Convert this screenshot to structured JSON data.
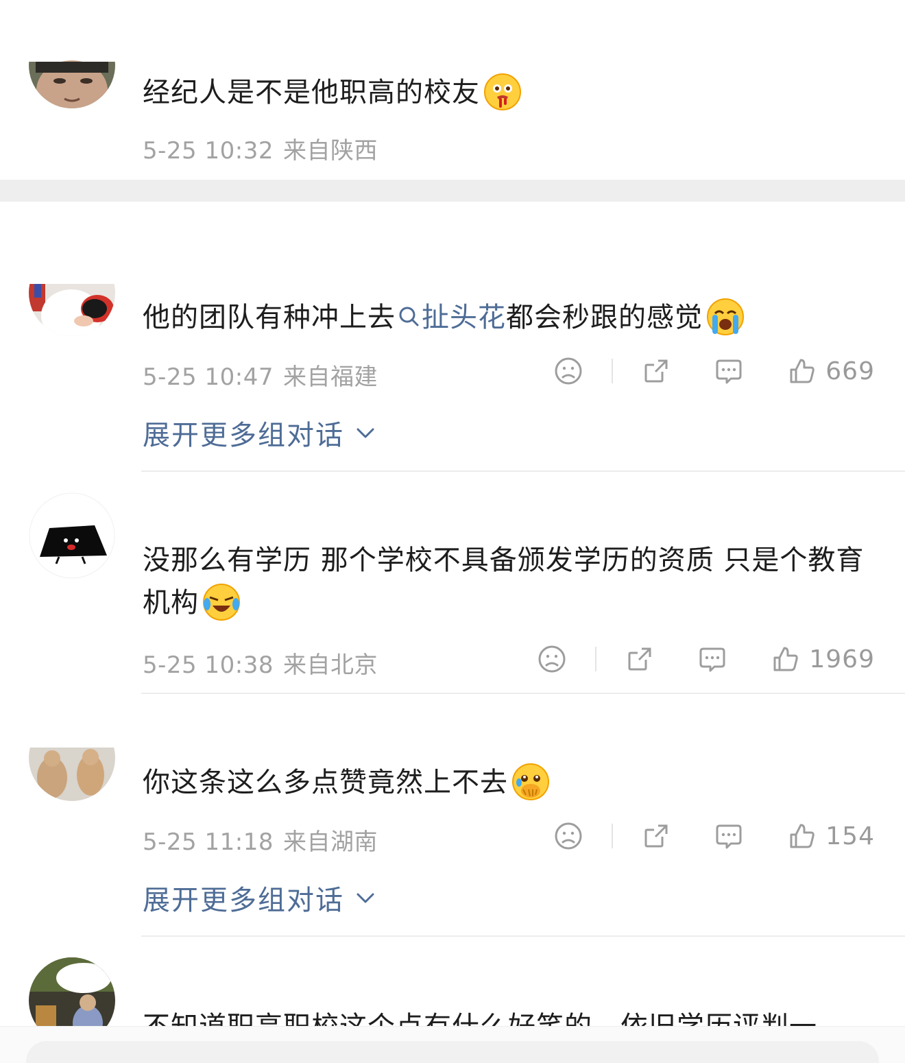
{
  "comments": [
    {
      "text": "经纪人是不是他职高的校友",
      "time": "5-25 10:32",
      "location": "来自陕西"
    },
    {
      "text_before": "他的团队有种冲上去",
      "topic": "扯头花",
      "text_after": "都会秒跟的感觉",
      "time": "5-25 10:47",
      "location": "来自福建",
      "likes": "669",
      "expand": "展开更多组对话"
    },
    {
      "text": "没那么有学历 那个学校不具备颁发学历的资质 只是个教育机构",
      "time": "5-25 10:38",
      "location": "来自北京",
      "likes": "1969"
    },
    {
      "text": "你这条这么多点赞竟然上不去",
      "time": "5-25 11:18",
      "location": "来自湖南",
      "likes": "154",
      "expand": "展开更多组对话"
    },
    {
      "text": "不知道职高职校这个点有什么好笑的，依旧学历评判一"
    }
  ],
  "colors": {
    "link": "#4e6c96",
    "meta": "#a2a2a2",
    "icon": "#9d9d9d",
    "divider": "#ececec"
  },
  "icons": [
    "dislike-face-icon",
    "repost-icon",
    "comment-icon",
    "like-thumb-icon",
    "search-icon",
    "chevron-down-icon"
  ]
}
